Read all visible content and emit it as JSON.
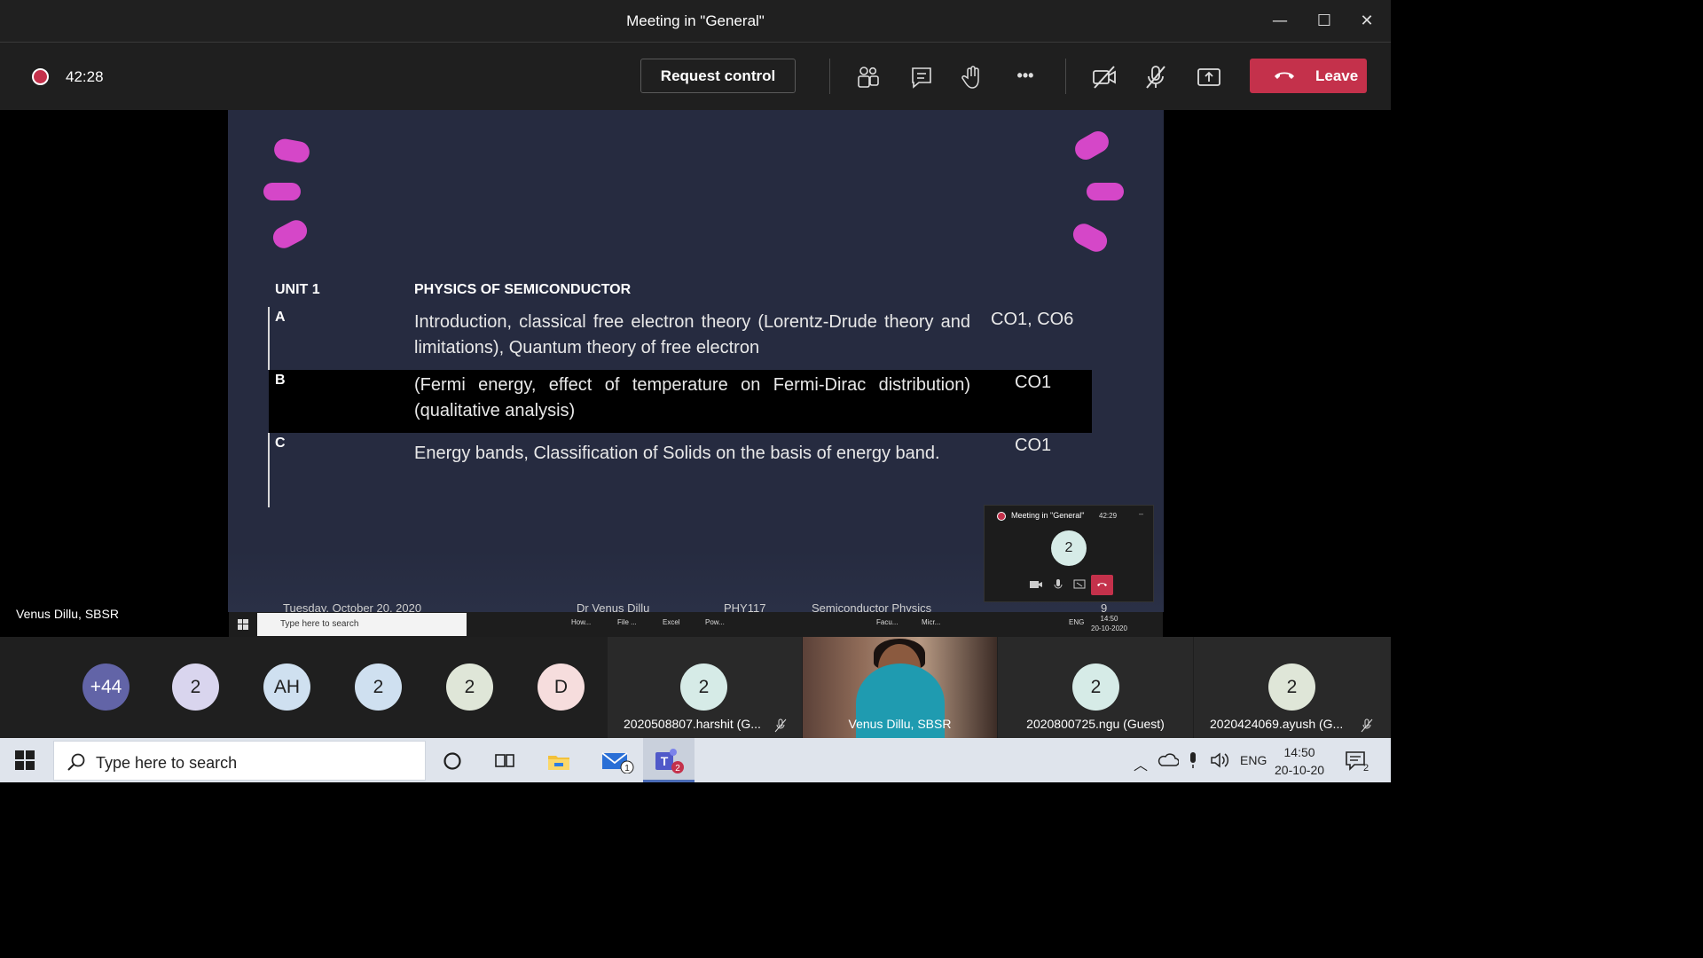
{
  "window": {
    "title": "Meeting in \"General\"",
    "minimize": "—",
    "maximize": "☐",
    "close": "✕"
  },
  "toolbar": {
    "recording_time": "42:28",
    "request_control": "Request control",
    "more": "•••",
    "leave": "Leave",
    "leave_color": "#c4314b",
    "icons": [
      "participants-icon",
      "chat-icon",
      "raise-hand-icon",
      "more-icon",
      "camera-off-icon",
      "mic-off-icon",
      "share-screen-icon"
    ]
  },
  "slide": {
    "unit": "UNIT 1",
    "heading": "PHYSICS OF SEMICONDUCTOR",
    "rows": [
      {
        "letter": "A",
        "text": "Introduction, classical free electron theory (Lorentz-Drude theory and limitations), Quantum theory of free electron",
        "co": "CO1, CO6"
      },
      {
        "letter": "B",
        "text": "(Fermi energy, effect of temperature on Fermi-Dirac distribution) (qualitative analysis)",
        "co": "CO1"
      },
      {
        "letter": "C",
        "text": "Energy bands, Classification of Solids on the basis of energy band.",
        "co": "CO1"
      }
    ],
    "footer": {
      "date": "Tuesday, October 20, 2020",
      "author": "Dr Venus Dillu",
      "course": "PHY117",
      "subject": "Semiconductor Physics",
      "page": "9"
    }
  },
  "mini_window": {
    "title": "Meeting in \"General\"",
    "time": "42:29",
    "minimize": "–",
    "count": "2"
  },
  "presenter_taskbar": {
    "search_placeholder": "Type here to search",
    "apps": [
      "How...",
      "File ...",
      "Excel",
      "Pow...",
      "Facu...",
      "Micr..."
    ],
    "lang": "ENG",
    "time": "14:50",
    "date": "20-10-2020"
  },
  "presenter_name": "Venus Dillu, SBSR",
  "participants": {
    "avatars": [
      {
        "label": "+44",
        "bg": "#6264a7",
        "fg": "#ffffff"
      },
      {
        "label": "2",
        "bg": "#d9d5ee",
        "fg": "#1f1f1f"
      },
      {
        "label": "AH",
        "bg": "#cfe0f0",
        "fg": "#1f1f1f"
      },
      {
        "label": "2",
        "bg": "#cfe0f0",
        "fg": "#1f1f1f"
      },
      {
        "label": "2",
        "bg": "#dfe6d8",
        "fg": "#1f1f1f"
      },
      {
        "label": "D",
        "bg": "#f6dddd",
        "fg": "#1f1f1f"
      }
    ],
    "tiles": [
      {
        "avatar": "2",
        "name": "2020508807.harshit (G..."
      },
      {
        "name": "Venus Dillu, SBSR"
      },
      {
        "avatar": "2",
        "name": "2020800725.ngu (Guest)"
      },
      {
        "avatar": "2",
        "name": "2020424069.ayush (G..."
      }
    ]
  },
  "windows_taskbar": {
    "search_placeholder": "Type here to search",
    "mail_badge": "1",
    "teams_badge": "2",
    "lang": "ENG",
    "time": "14:50",
    "date": "20-10-20",
    "notification_badge": "2"
  }
}
